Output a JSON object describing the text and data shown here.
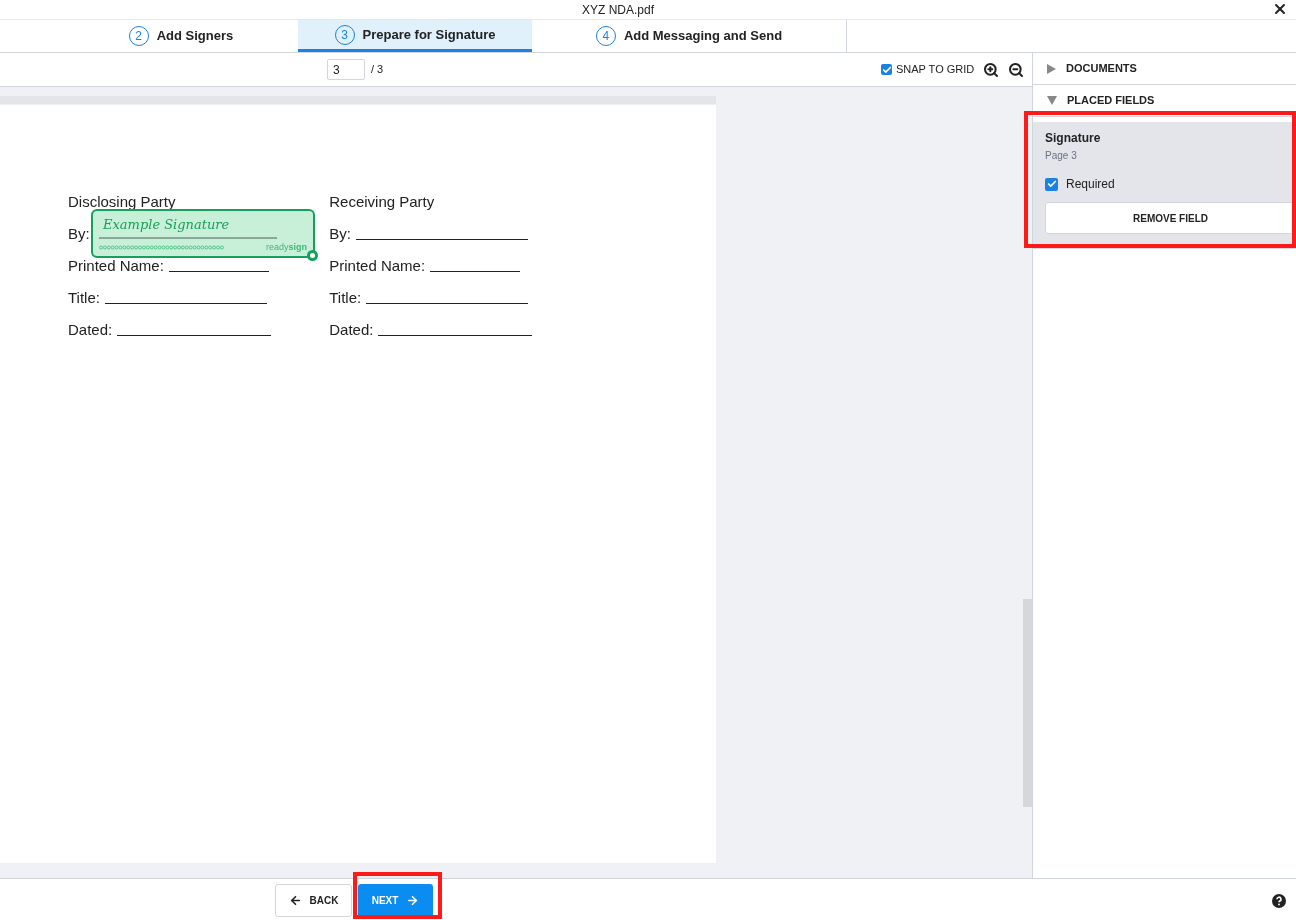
{
  "window": {
    "title": "XYZ NDA.pdf"
  },
  "steps": [
    {
      "number": "2",
      "label": "Add Signers",
      "selected": false
    },
    {
      "number": "3",
      "label": "Prepare for Signature",
      "selected": true
    },
    {
      "number": "4",
      "label": "Add Messaging and Send",
      "selected": false
    }
  ],
  "toolbar": {
    "page": "3",
    "page_total": "/ 3",
    "snap_to_grid": {
      "label": "SNAP TO GRID",
      "checked": true
    }
  },
  "document": {
    "columns": [
      {
        "heading": "Disclosing Party",
        "lines": [
          "By:",
          "Printed Name:",
          "Title:",
          "Dated:"
        ]
      },
      {
        "heading": "Receiving Party",
        "lines": [
          "By:",
          "Printed Name:",
          "Title:",
          "Dated:"
        ]
      }
    ],
    "signature_field": {
      "text": "Example Signature",
      "brand_light": "ready",
      "brand_bold": "sign"
    }
  },
  "sidebar": {
    "sections": [
      {
        "label": "DOCUMENTS",
        "expanded": false
      },
      {
        "label": "PLACED FIELDS",
        "expanded": true
      }
    ],
    "field": {
      "name": "Signature",
      "page": "Page 3",
      "required": {
        "label": "Required",
        "checked": true
      },
      "remove": "REMOVE FIELD"
    }
  },
  "footer": {
    "back": "BACK",
    "next": "NEXT"
  }
}
